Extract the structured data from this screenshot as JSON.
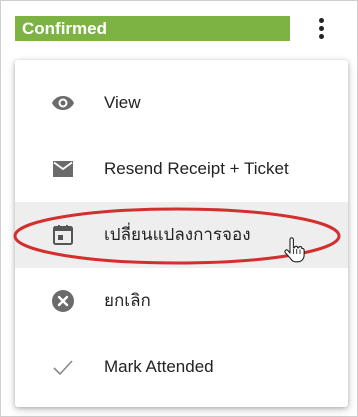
{
  "status": {
    "label": "Confirmed",
    "color": "#7cb342"
  },
  "more_button": {
    "icon": "more-vertical-icon"
  },
  "menu": {
    "items": [
      {
        "label": "View",
        "icon": "eye-icon"
      },
      {
        "label": "Resend Receipt + Ticket",
        "icon": "envelope-icon"
      },
      {
        "label": "เปลี่ยนแปลงการจอง",
        "icon": "calendar-icon",
        "hovered": true
      },
      {
        "label": "ยกเลิก",
        "icon": "cancel-circle-icon"
      },
      {
        "label": "Mark Attended",
        "icon": "checkmark-icon"
      }
    ]
  },
  "annotation": {
    "color": "#d32f2f"
  }
}
